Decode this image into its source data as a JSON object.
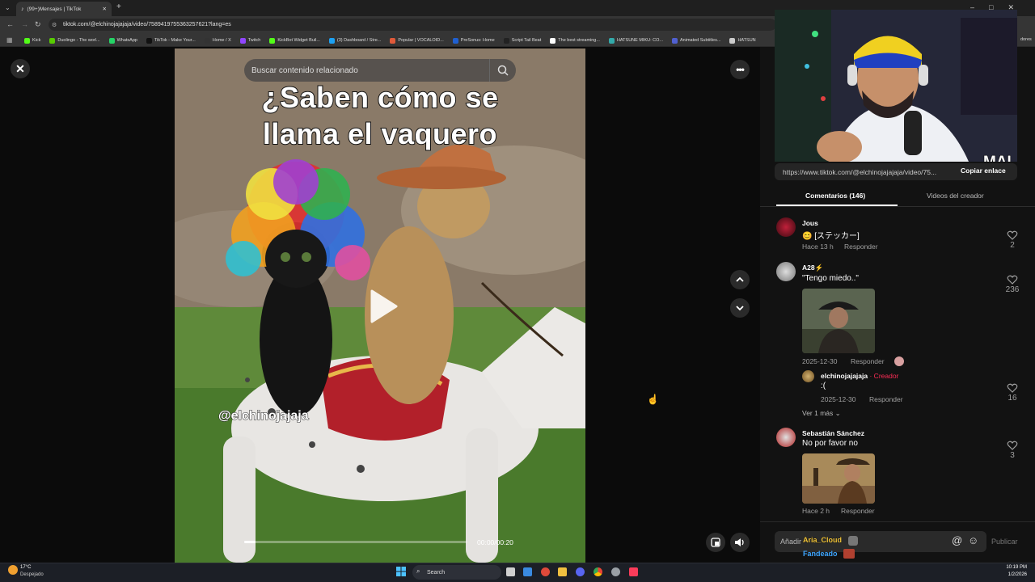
{
  "browser": {
    "tab_title": "(99+)Mensajes | TikTok",
    "url": "tiktok.com/@elchinojajajaja/video/7589419755363257621?lang=es",
    "bookmarks": [
      "Kick",
      "Duolingo - The worl...",
      "WhatsApp",
      "TikTok - Make Your...",
      "Home / X",
      "Twitch",
      "KickBot Widget Buil...",
      "(3) Dashboard / Stre...",
      "Popular | VOCALOID...",
      "PreSonus: Home",
      "Script Tail Beat",
      "The best streaming...",
      "HATSUNE MIKU: CO...",
      "Animated Subtitles...",
      "HATSUN"
    ],
    "bookmarks_overflow": "dores"
  },
  "viewer": {
    "search_placeholder": "Buscar contenido relacionado",
    "caption_line1": "¿Saben cómo se",
    "caption_line2": "llama el vaquero",
    "watermark": "@elchinojajaja",
    "time": "00:00/00:20",
    "progress_fraction": 0.05
  },
  "panel": {
    "cam_overlay": "MAI",
    "share_link": "https://www.tiktok.com/@elchinojajajaja/video/75...",
    "copy_label": "Copiar enlace",
    "tabs": [
      "Comentarios (146)",
      "Videos del creador"
    ],
    "comments": [
      {
        "name": "Jous",
        "text": "😊 [ステッカー]",
        "time": "Hace 13 h",
        "reply": "Responder",
        "likes": "2"
      },
      {
        "name": "A28⚡",
        "text": "\"Tengo miedo..\"",
        "time": "2025-12-30",
        "reply": "Responder",
        "likes": "236"
      },
      {
        "name": "elchinojajajaja",
        "creator_tag": " · Creador",
        "text": ":(",
        "time": "2025-12-30",
        "reply": "Responder",
        "likes": "16"
      },
      {
        "name": "Sebastián Sánchez",
        "text": "No por favor no",
        "time": "Hace 2 h",
        "reply": "Responder",
        "likes": "3"
      }
    ],
    "view_more": "Ver 1 más",
    "add_comment_placeholder": "Añadir",
    "overlay_name": "Aria_Cloud",
    "overlay_status": "Fandeado",
    "publish_label": "Publicar"
  },
  "taskbar": {
    "weather_temp": "17°C",
    "weather_desc": "Despejado",
    "search_label": "Search",
    "clock_time": "10:19 PM",
    "clock_date": "1/2/2026"
  },
  "colors": {
    "creator_tag": "#fe2c55",
    "overlay_name": "#f3c63c",
    "overlay_status": "#3ea6ff"
  }
}
